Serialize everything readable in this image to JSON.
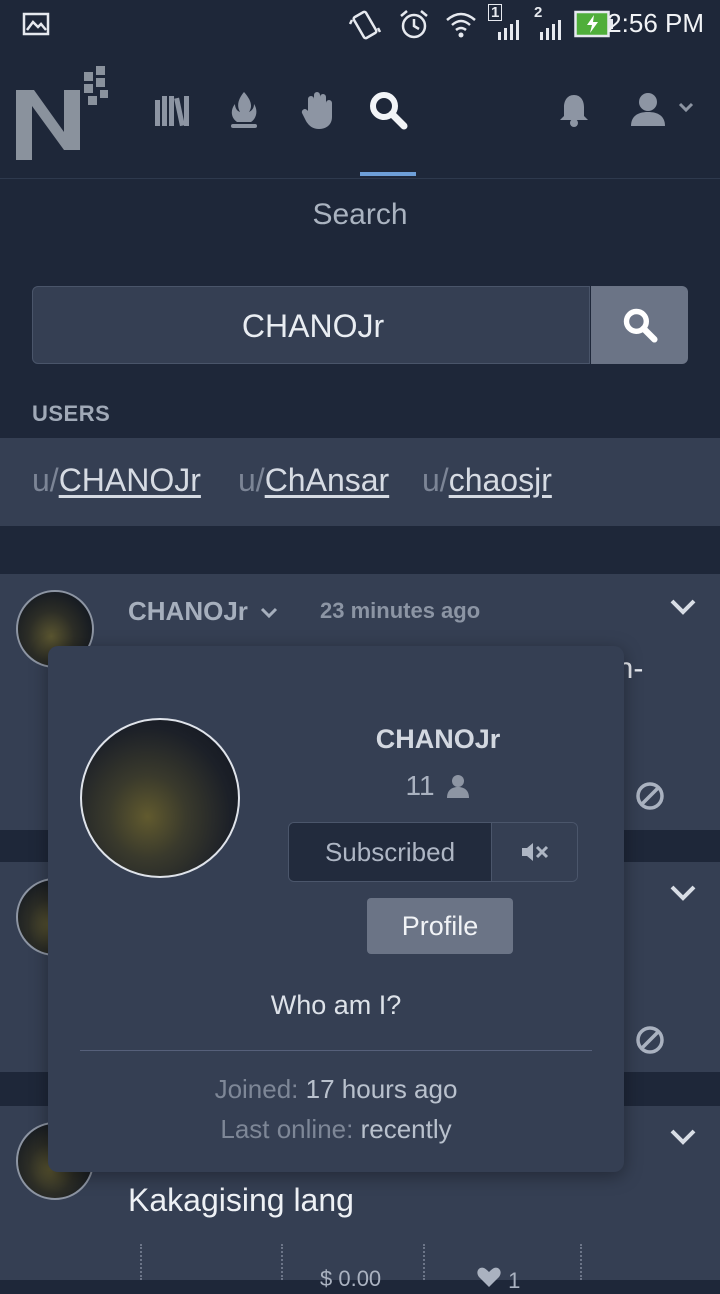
{
  "status_bar": {
    "time": "2:56 PM",
    "sim1": "1",
    "sim2": "2",
    "icons": [
      "image-icon",
      "vibrate-icon",
      "alarm-icon",
      "wifi-icon",
      "signal-icon",
      "battery-charging-icon"
    ]
  },
  "nav": {
    "logo": "N",
    "items": [
      {
        "icon": "library-icon"
      },
      {
        "icon": "flame-icon"
      },
      {
        "icon": "raised-hand-icon"
      },
      {
        "icon": "search-icon",
        "active": true
      }
    ],
    "right": [
      "bell-icon",
      "user-menu-icon"
    ]
  },
  "page": {
    "title": "Search"
  },
  "search": {
    "query": "CHANOJr"
  },
  "users": {
    "heading": "USERS",
    "prefix": "u/",
    "items": [
      "CHANOJr",
      "ChAnsar",
      "chaosjr"
    ]
  },
  "post1": {
    "author": "CHANOJr",
    "time": "23 minutes ago",
    "clipped_text": "an-"
  },
  "post3": {
    "text": "Kakagising lang",
    "tip": "$ 0.00",
    "likes": "1"
  },
  "popover": {
    "name": "CHANOJr",
    "subscriber_count": "11",
    "subscribed_label": "Subscribed",
    "profile_label": "Profile",
    "bio": "Who am I?",
    "joined_label": "Joined:",
    "joined_value": "17 hours ago",
    "online_label": "Last online:",
    "online_value": "recently"
  },
  "colors": {
    "background": "#1e2739",
    "card": "#353f53",
    "accent": "#6e9fd8",
    "button": "#6b7486"
  }
}
